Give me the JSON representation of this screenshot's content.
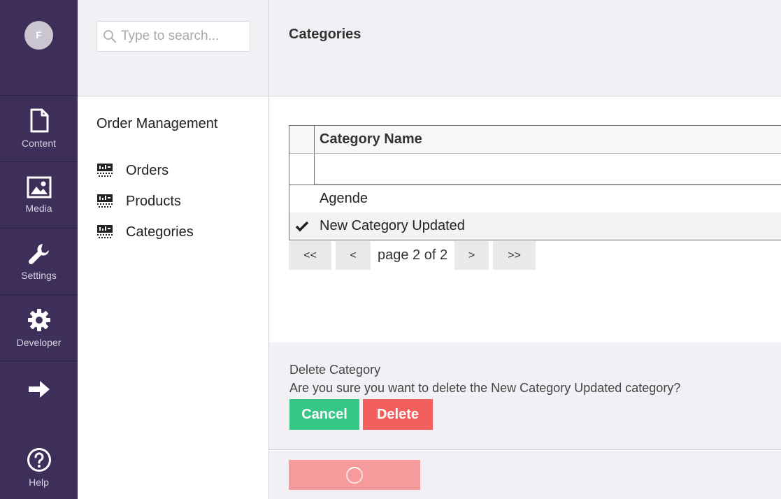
{
  "user": {
    "initial": "F"
  },
  "rail": {
    "items": [
      {
        "label": "Content",
        "icon": "document-icon"
      },
      {
        "label": "Media",
        "icon": "image-icon"
      },
      {
        "label": "Settings",
        "icon": "wrench-icon"
      },
      {
        "label": "Developer",
        "icon": "gear-icon"
      }
    ],
    "arrow_icon": "arrow-right-icon",
    "help": {
      "label": "Help",
      "icon": "help-circle-icon"
    }
  },
  "tree": {
    "search_placeholder": "Type to search...",
    "section_title": "Order Management",
    "items": [
      {
        "label": "Orders",
        "icon": "list-grid-icon"
      },
      {
        "label": "Products",
        "icon": "list-grid-icon"
      },
      {
        "label": "Categories",
        "icon": "list-grid-icon"
      }
    ]
  },
  "main": {
    "title": "Categories",
    "grid": {
      "header": "Category Name",
      "filter_value": "",
      "rows": [
        {
          "name": "Agende",
          "selected": false
        },
        {
          "name": "New Category Updated",
          "selected": true
        }
      ]
    },
    "pager": {
      "first": "<<",
      "prev": "<",
      "status": "page 2 of 2",
      "next": ">",
      "last": ">>"
    },
    "confirm": {
      "heading": "Delete Category",
      "message": "Are you sure you want to delete the New Category Updated category?",
      "cancel_label": "Cancel",
      "delete_label": "Delete"
    }
  },
  "colors": {
    "rail_bg": "#3d2f5a",
    "header_bg": "#f3f0f5",
    "cancel": "#35c786",
    "delete": "#f25f5c",
    "save_loading": "#f59b9b"
  }
}
